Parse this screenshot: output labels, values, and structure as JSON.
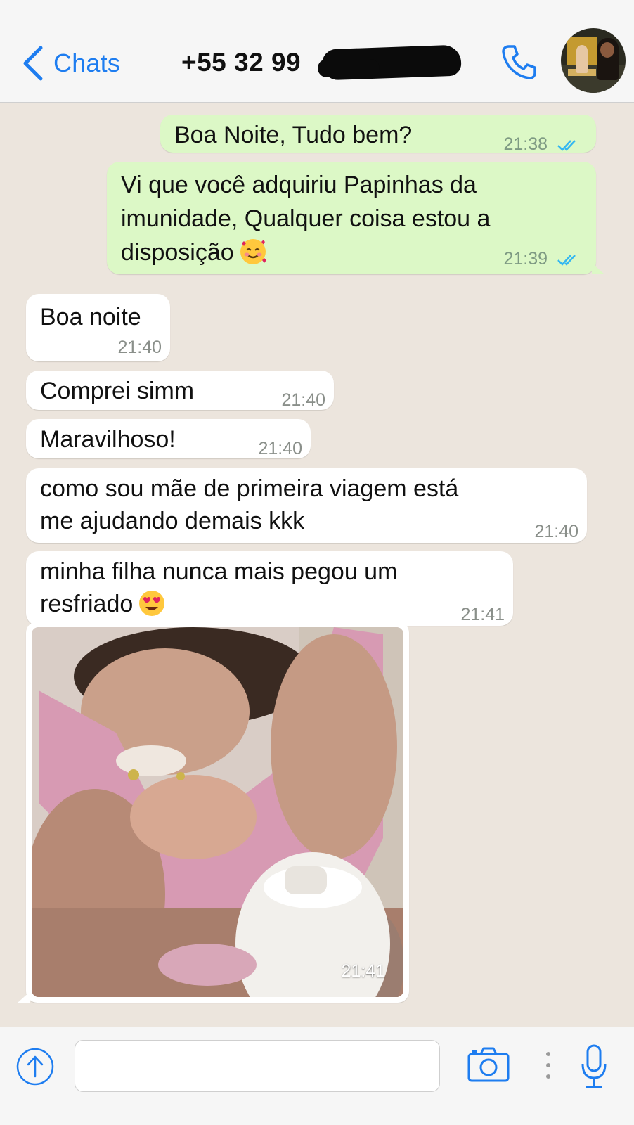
{
  "header": {
    "back_label": "Chats",
    "contact_title": "+55 32 99",
    "phone_icon": "phone-icon",
    "avatar_icon": "contact-avatar"
  },
  "messages": [
    {
      "direction": "outgoing",
      "text": "Boa Noite, Tudo bem?",
      "time": "21:38",
      "status": "read"
    },
    {
      "direction": "outgoing",
      "lines": [
        "Vi que você adquiriu Papinhas da",
        "imunidade, Qualquer coisa estou a",
        "disposição"
      ],
      "emoji": "smiling-face-with-hearts",
      "time": "21:39",
      "status": "read"
    },
    {
      "direction": "incoming",
      "text": "Boa noite",
      "time": "21:40"
    },
    {
      "direction": "incoming",
      "text": "Comprei simm",
      "time": "21:40"
    },
    {
      "direction": "incoming",
      "text": "Maravilhoso!",
      "time": "21:40"
    },
    {
      "direction": "incoming",
      "lines": [
        "como sou mãe de primeira viagem está",
        "me ajudando demais kkk"
      ],
      "time": "21:40"
    },
    {
      "direction": "incoming",
      "lines": [
        "minha filha nunca mais pegou um",
        "resfriado"
      ],
      "emoji": "heart-eyes",
      "time": "21:41"
    },
    {
      "direction": "incoming",
      "type": "photo",
      "time": "21:41"
    }
  ],
  "input_bar": {
    "upload_icon": "upload-arrow-icon",
    "input_value": "",
    "input_placeholder": "",
    "camera_icon": "camera-icon",
    "mic_icon": "microphone-icon"
  },
  "colors": {
    "chat_background": "#ECE5DD",
    "outgoing_bubble": "#DCF8C6",
    "incoming_bubble": "#FFFFFF",
    "accent": "#1E7DF0",
    "read_ticks": "#34B7F1"
  }
}
